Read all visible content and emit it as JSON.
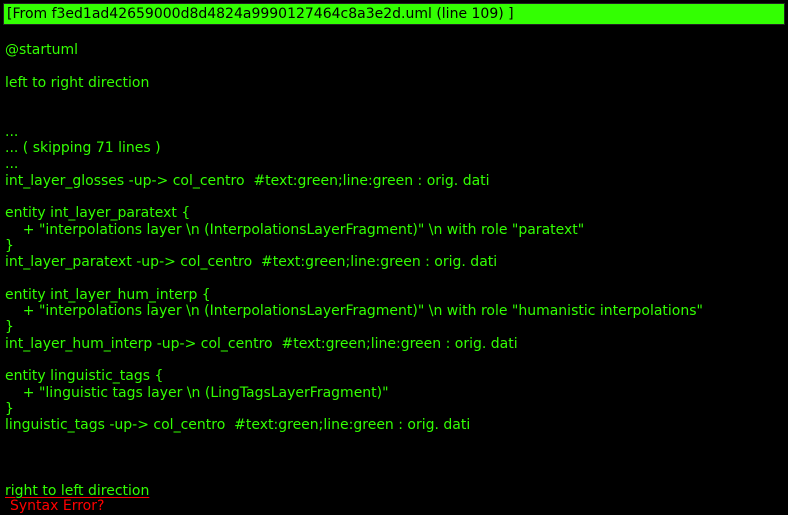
{
  "header": {
    "text": "[From f3ed1ad42659000d8d4824a9990127464c8a3e2d.uml (line 109) ]"
  },
  "colors": {
    "background": "#000000",
    "header_background": "#33ff02",
    "code_text": "#33ff02",
    "error_text": "#ff0000"
  },
  "lines": [
    "@startuml",
    "left to right direction",
    "...",
    "... ( skipping 71 lines )",
    "...",
    "int_layer_glosses -up-> col_centro  #text:green;line:green : orig. dati",
    "entity int_layer_paratext {",
    "    + \"interpolations layer \\n (InterpolationsLayerFragment)\" \\n with role \"paratext\"",
    "}",
    "int_layer_paratext -up-> col_centro  #text:green;line:green : orig. dati",
    "entity int_layer_hum_interp {",
    "    + \"interpolations layer \\n (InterpolationsLayerFragment)\" \\n with role \"humanistic interpolations\"",
    "}",
    "int_layer_hum_interp -up-> col_centro  #text:green;line:green : orig. dati",
    "entity linguistic_tags {",
    "    + \"linguistic tags layer \\n (LingTagsLayerFragment)\"",
    "}",
    "linguistic_tags -up-> col_centro  #text:green;line:green : orig. dati"
  ],
  "error_line": "right to left direction",
  "error_message": "Syntax Error?"
}
